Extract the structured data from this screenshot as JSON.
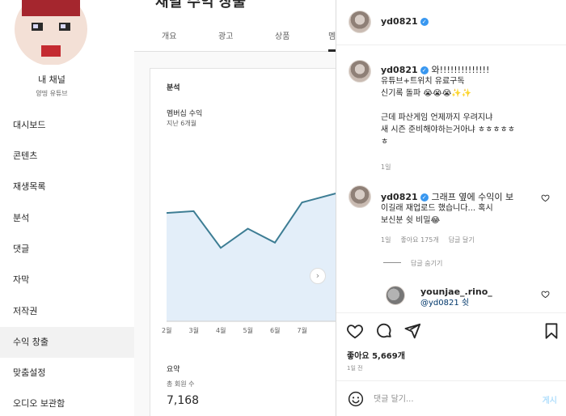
{
  "studio": {
    "channel_name": "내 채널",
    "channel_handle": "양띵 유튜브",
    "page_title": "채널 수익 창출",
    "nav_items": [
      {
        "label": "대시보드",
        "active": false
      },
      {
        "label": "콘텐츠",
        "active": false
      },
      {
        "label": "재생목록",
        "active": false
      },
      {
        "label": "분석",
        "active": false
      },
      {
        "label": "댓글",
        "active": false
      },
      {
        "label": "자막",
        "active": false
      },
      {
        "label": "저작권",
        "active": false
      },
      {
        "label": "수익 창출",
        "active": true
      },
      {
        "label": "맞춤설정",
        "active": false
      },
      {
        "label": "오디오 보관함",
        "active": false
      }
    ],
    "tabs": [
      "개요",
      "광고",
      "상품",
      "멤"
    ],
    "analytics_card": {
      "section_label": "분석",
      "metric_title": "멤버십 수익",
      "period": "지난 6개월",
      "summary_label": "요약",
      "summary_metric": "총 회원 수",
      "summary_value": "7,168"
    },
    "next_icon": "chevron-right-icon"
  },
  "chart_data": {
    "type": "area",
    "title": "멤버십 수익",
    "subtitle": "지난 6개월",
    "x": [
      "2월",
      "3월",
      "4월",
      "5월",
      "6월",
      "7월"
    ],
    "series": [
      {
        "values": [
          0.62,
          0.63,
          0.42,
          0.53,
          0.45,
          0.68
        ]
      }
    ],
    "y_axis_visible": false,
    "line_color": "#3d7d94",
    "fill_color": "#e3eef9"
  },
  "instagram": {
    "post_author": "yd0821",
    "comments": [
      {
        "username": "yd0821",
        "verified": true,
        "lines": [
          "와!!!!!!!!!!!!!!",
          "유튜브+트위치 유료구독",
          "신기록 돌파 😭😭😭✨✨",
          "",
          "근데 파산게임 언제까지 우려지냐",
          "새 시즌 준비해야하는거아냐 ㅎㅎㅎㅎㅎ",
          "ㅎ"
        ],
        "time": "1일"
      },
      {
        "username": "yd0821",
        "verified": true,
        "lines": [
          "그래프 옆에 수익이 보",
          "이길래 재업로드 했습니다... 혹시",
          "보신분 쉿 비밀😂"
        ],
        "time": "1일",
        "likes": "좋아요 175개",
        "reply_action": "답글 달기"
      }
    ],
    "hide_replies_label": "답글 숨기기",
    "reply": {
      "username": "younjae_.rino_",
      "text": "@yd0821 쉿"
    },
    "like_count_text": "좋아요 5,669개",
    "post_time": "1일 전",
    "comment_placeholder": "댓글 달기...",
    "post_button_label": "게시",
    "accent_color": "#3897f0"
  }
}
